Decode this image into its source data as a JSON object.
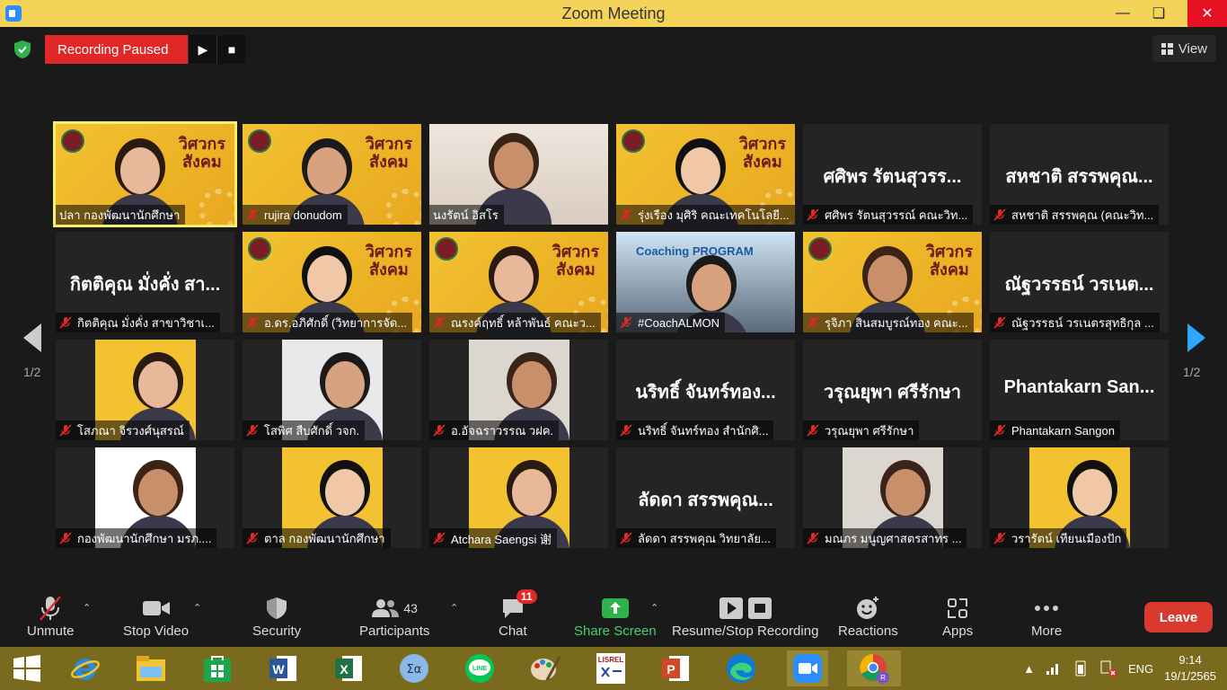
{
  "window": {
    "title": "Zoom Meeting"
  },
  "recording": {
    "status": "Recording Paused"
  },
  "view_button": {
    "label": "View"
  },
  "pager": {
    "left": "1/2",
    "right": "1/2"
  },
  "tiles": [
    {
      "name": "ปลา กองพัฒนานักศึกษา",
      "big": "",
      "kind": "banner",
      "muted": false
    },
    {
      "name": "rujira donudom",
      "big": "",
      "kind": "banner",
      "muted": true
    },
    {
      "name": "นงรัตน์ อิสโร",
      "big": "",
      "kind": "room",
      "muted": false
    },
    {
      "name": "รุ่งเรือง มุศิริ คณะเทคโนโลยี...",
      "big": "",
      "kind": "banner",
      "muted": true
    },
    {
      "name": "ศศิพร รัตนสุวรรณ์ คณะวิท...",
      "big": "ศศิพร รัตนสุวรร...",
      "kind": "text",
      "muted": true
    },
    {
      "name": "สหชาติ สรรพคุณ (คณะวิท...",
      "big": "สหชาติ สรรพคุณ...",
      "kind": "text",
      "muted": true
    },
    {
      "name": "กิตติคุณ มั่งคั่ง สาขาวิชาเ...",
      "big": "กิตติคุณ มั่งคั่ง สา...",
      "kind": "text",
      "muted": true
    },
    {
      "name": "อ.ดร.อภิศักดิ์ (วิทยาการจัด...",
      "big": "",
      "kind": "banner",
      "muted": true
    },
    {
      "name": "ณรงค์ฤทธิ์ หล้าพันธ์ คณะว...",
      "big": "",
      "kind": "banner",
      "muted": true
    },
    {
      "name": "#CoachALMON",
      "big": "",
      "kind": "coach",
      "muted": true
    },
    {
      "name": "รุจิภา สินสมบูรณ์ทอง คณะ...",
      "big": "",
      "kind": "banner",
      "muted": true
    },
    {
      "name": "ณัฐวรรธน์ วรเนตรสุทธิกุล ...",
      "big": "ณัฐวรรธน์ วรเนต...",
      "kind": "text",
      "muted": true
    },
    {
      "name": "โสภณา จิรวงศ์นุสรณ์",
      "big": "",
      "kind": "photo",
      "muted": true
    },
    {
      "name": "โสพิศ สืบศักดิ์ วจก.",
      "big": "",
      "kind": "photo",
      "muted": true
    },
    {
      "name": "อ.อัจฉราวรรณ วฝค.",
      "big": "",
      "kind": "photo",
      "muted": true
    },
    {
      "name": "นริทธิ์ จันทร์ทอง สำนักศิ...",
      "big": "นริทธิ์ จันทร์ทอง...",
      "kind": "text",
      "muted": true
    },
    {
      "name": "วรุณยุพา ศรีรักษา",
      "big": "วรุณยุพา ศรีรักษา",
      "kind": "text",
      "muted": true
    },
    {
      "name": "Phantakarn Sangon",
      "big": "Phantakarn San...",
      "kind": "text",
      "muted": true
    },
    {
      "name": "กองพัฒนานักศึกษา มรภ....",
      "big": "",
      "kind": "photo",
      "muted": true
    },
    {
      "name": "ตาล กองพัฒนานักศึกษา",
      "big": "",
      "kind": "photo",
      "muted": true
    },
    {
      "name": "Atchara Saengsi 谢",
      "big": "",
      "kind": "photo",
      "muted": true
    },
    {
      "name": "ลัดดา สรรพคุณ วิทยาลัย...",
      "big": "ลัดดา สรรพคุณ...",
      "kind": "text",
      "muted": true
    },
    {
      "name": "มณภร มนูญศาสตรสาทร ...",
      "big": "",
      "kind": "photo",
      "muted": true
    },
    {
      "name": "วรารัตน์ เทียนเมืองปัก",
      "big": "",
      "kind": "photo",
      "muted": true
    }
  ],
  "banner_text": {
    "line1": "วิศวกร",
    "line2": "สังคม"
  },
  "coach_text": "Coaching PROGRAM",
  "toolbar": {
    "unmute": "Unmute",
    "stop_video": "Stop Video",
    "security": "Security",
    "participants": "Participants",
    "participants_count": "43",
    "chat": "Chat",
    "chat_badge": "11",
    "share": "Share Screen",
    "recording": "Resume/Stop Recording",
    "reactions": "Reactions",
    "apps": "Apps",
    "more": "More",
    "leave": "Leave"
  },
  "taskbar": {
    "lang": "ENG",
    "time": "9:14",
    "date": "19/1/2565",
    "apps": [
      "windows-start",
      "internet-explorer",
      "file-explorer",
      "store",
      "word",
      "excel",
      "math-input",
      "line",
      "paint",
      "lisrel",
      "powerpoint",
      "edge",
      "zoom",
      "chrome"
    ]
  },
  "colors": {
    "accent": "#2d8cff",
    "title_bar": "#f4d458",
    "leave": "#d93a2f",
    "record": "#e02828",
    "taskbar": "#7a6a1e"
  }
}
